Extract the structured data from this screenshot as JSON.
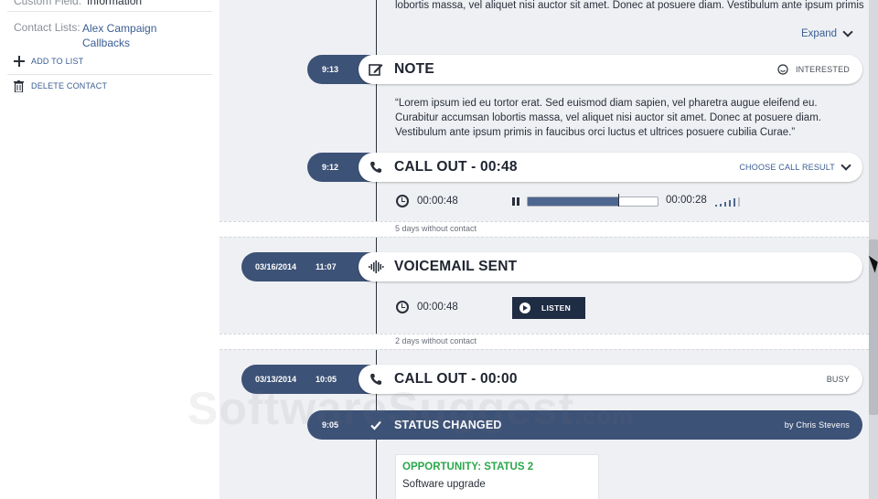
{
  "sidebar": {
    "custom_field_label": "Custom Field:",
    "custom_field_value": "Information",
    "contact_lists_label": "Contact Lists:",
    "contact_lists": [
      "Alex Campaign",
      "Callbacks"
    ],
    "add_to_list": "ADD TO LIST",
    "delete_contact": "DELETE CONTACT"
  },
  "timeline": {
    "top_text": "lobortis massa, vel aliquet nisi auctor sit amet. Donec at posuere diam. Vestibulum ante ipsum primis",
    "expand_label": "Expand",
    "note": {
      "time": "9:13",
      "title": "NOTE",
      "status": "INTERESTED",
      "body": "“Lorem ipsum ied eu tortor erat. Sed euismod diam sapien, vel pharetra augue eleifend eu. Curabitur accumsan lobortis massa, vel aliquet nisi auctor sit amet. Donec at posuere diam. Vestibulum ante ipsum primis in faucibus orci luctus et ultrices posuere cubilia Curae.”"
    },
    "call_out_1": {
      "time": "9:12",
      "title": "CALL OUT - 00:48",
      "result_label": "CHOOSE CALL RESULT",
      "duration": "00:00:48",
      "remaining": "00:00:28",
      "progress": 0.7
    },
    "gap_1": "5 days without contact",
    "voicemail": {
      "date": "03/16/2014",
      "time": "11:07",
      "title": "VOICEMAIL SENT",
      "duration": "00:00:48",
      "listen_label": "LISTEN"
    },
    "gap_2": "2 days without contact",
    "call_out_2": {
      "date": "03/13/2014",
      "time": "10:05",
      "title": "CALL OUT - 00:00",
      "status": "BUSY"
    },
    "status_changed": {
      "time": "9:05",
      "title": "STATUS CHANGED",
      "by": "by Chris Stevens",
      "opportunity": "OPPORTUNITY: STATUS 2",
      "detail": "Software upgrade"
    }
  },
  "watermark": {
    "main": "SoftwareSuggest",
    "suffix": ".com"
  },
  "colors": {
    "accent": "#3d5277",
    "link": "#3a5d93",
    "success": "#2aa84a"
  }
}
